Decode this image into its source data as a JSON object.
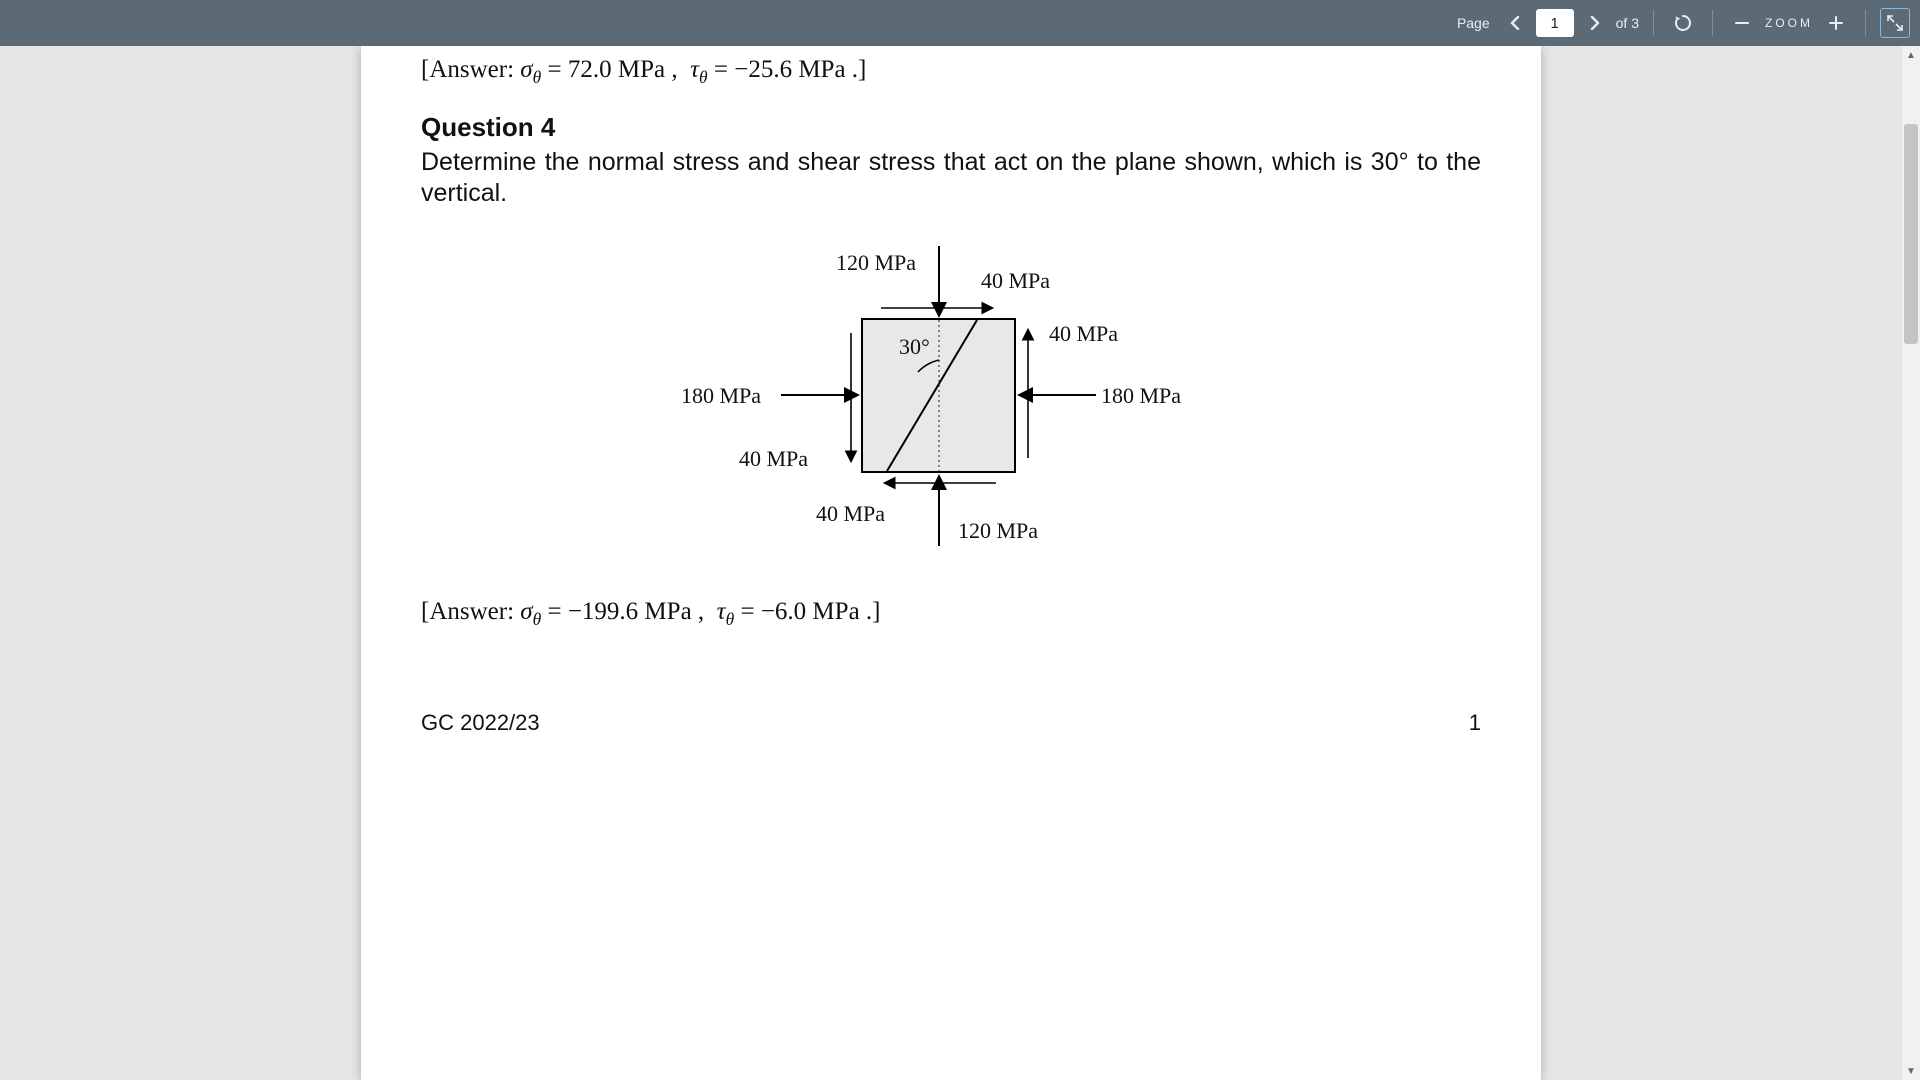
{
  "toolbar": {
    "page_label": "Page",
    "page_input_value": "1",
    "of_label": "of 3",
    "zoom_label": "ZOOM"
  },
  "document": {
    "prev_answer": "[Answer: σθ = 72.0 MPa ,  τθ = −25.6 MPa .]",
    "question_number": "Question 4",
    "question_text": "Determine the normal stress and shear stress that act on the plane shown, which is 30° to the vertical.",
    "figure": {
      "angle_label": "30°",
      "top_load": "120 MPa",
      "bottom_load": "120 MPa",
      "left_load": "180 MPa",
      "right_load": "180 MPa",
      "shear_top_right": "40 MPa",
      "shear_right": "40 MPa",
      "shear_left": "40 MPa",
      "shear_bottom_left": "40 MPa"
    },
    "answer": "[Answer: σθ = −199.6 MPa ,  τθ = −6.0 MPa .]",
    "footer_left": "GC 2022/23",
    "footer_right": "1"
  }
}
